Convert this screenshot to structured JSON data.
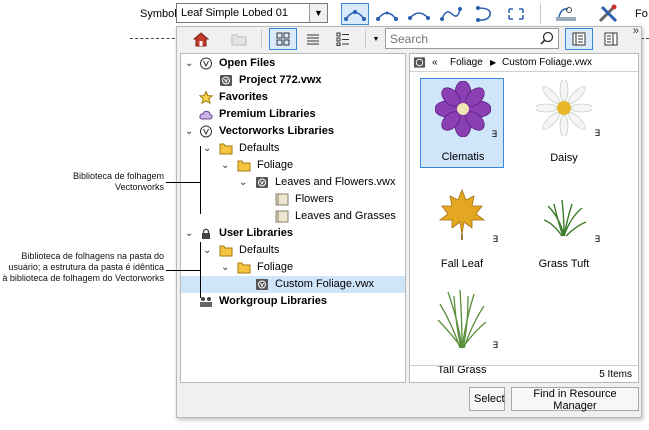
{
  "topbar": {
    "symbol_label": "Symbol",
    "symbol_value": "Leaf Simple Lobed 01",
    "fo_label": "Fo"
  },
  "panel": {
    "search_placeholder": "Search",
    "tree": [
      {
        "label": "Open Files",
        "level": 0,
        "bold": true,
        "expanded": true
      },
      {
        "label": "Project 772.vwx",
        "level": 1,
        "bold": true
      },
      {
        "label": "Favorites",
        "level": 0,
        "bold": true
      },
      {
        "label": "Premium Libraries",
        "level": 0,
        "bold": true
      },
      {
        "label": "Vectorworks Libraries",
        "level": 0,
        "bold": true,
        "expanded": true
      },
      {
        "label": "Defaults",
        "level": 1,
        "expanded": true
      },
      {
        "label": "Foliage",
        "level": 2,
        "expanded": true
      },
      {
        "label": "Leaves and Flowers.vwx",
        "level": 3,
        "expanded": true
      },
      {
        "label": "Flowers",
        "level": 4
      },
      {
        "label": "Leaves and Grasses",
        "level": 4
      },
      {
        "label": "User Libraries",
        "level": 0,
        "bold": true,
        "expanded": true
      },
      {
        "label": "Defaults",
        "level": 1,
        "expanded": true
      },
      {
        "label": "Foliage",
        "level": 2,
        "expanded": true
      },
      {
        "label": "Custom Foliage.vwx",
        "level": 3,
        "selected": true
      },
      {
        "label": "Workgroup Libraries",
        "level": 0,
        "bold": true
      }
    ],
    "breadcrumb": {
      "back": "«",
      "parts": [
        "Foliage",
        "Custom Foliage.vwx"
      ]
    },
    "resources": [
      {
        "label": "Clematis",
        "selected": true
      },
      {
        "label": "Daisy"
      },
      {
        "label": "Fall Leaf"
      },
      {
        "label": "Grass Tuft"
      },
      {
        "label": "Tall Grass"
      }
    ],
    "item_count": "5 Items",
    "select_button": "Select",
    "find_button": "Find in Resource Manager"
  },
  "annotations": {
    "note1": "Biblioteca de folhagem Vectorworks",
    "note2": "Biblioteca de folhagens na pasta do usuário; a estrutura da pasta é idêntica à biblioteca de folhagem do Vectorworks"
  },
  "colors": {
    "accent": "#3a86d8",
    "selection": "#cfe5f9",
    "folder": "#f5c542"
  }
}
